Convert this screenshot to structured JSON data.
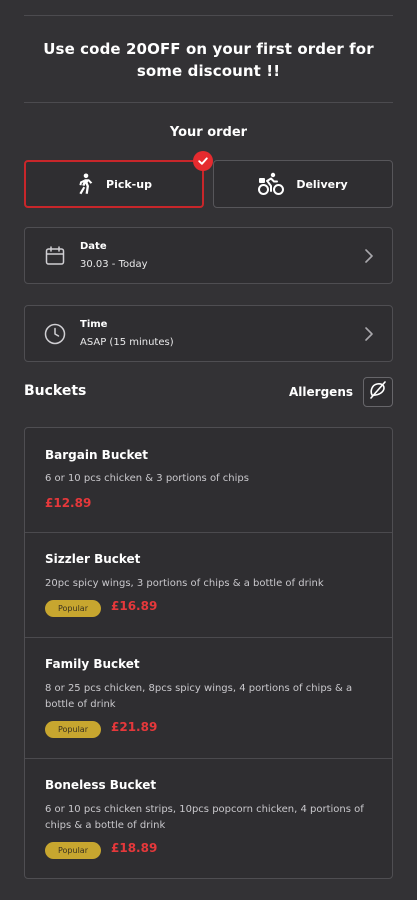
{
  "promo": {
    "text": "Use code 20OFF on your first order for some discount !!"
  },
  "order": {
    "heading": "Your order",
    "modes": [
      {
        "label": "Pick-up",
        "icon": "walking-person-icon",
        "selected": true
      },
      {
        "label": "Delivery",
        "icon": "bicycle-delivery-icon",
        "selected": false
      }
    ],
    "date": {
      "title": "Date",
      "value": "30.03 - Today",
      "icon": "calendar-icon"
    },
    "time": {
      "title": "Time",
      "value": "ASAP (15 minutes)",
      "icon": "clock-icon"
    }
  },
  "menu": {
    "section_title": "Buckets",
    "allergens_label": "Allergens",
    "items": [
      {
        "name": "Bargain Bucket",
        "description": "6 or 10 pcs chicken & 3 portions of chips",
        "price": "£12.89",
        "badge": ""
      },
      {
        "name": "Sizzler Bucket",
        "description": "20pc spicy wings, 3 portions of chips & a bottle of drink",
        "price": "£16.89",
        "badge": "Popular"
      },
      {
        "name": "Family Bucket",
        "description": "8 or 25 pcs chicken, 8pcs spicy wings, 4 portions of chips & a bottle of drink",
        "price": "£21.89",
        "badge": "Popular"
      },
      {
        "name": "Boneless Bucket",
        "description": "6 or 10 pcs chicken strips, 10pcs popcorn chicken, 4 portions of chips & a bottle of drink",
        "price": "£18.89",
        "badge": "Popular"
      }
    ]
  },
  "colors": {
    "background": "#333235",
    "accent_red": "#e52b2f",
    "price_red": "#e5383b",
    "badge_gold": "#c7a62f"
  }
}
